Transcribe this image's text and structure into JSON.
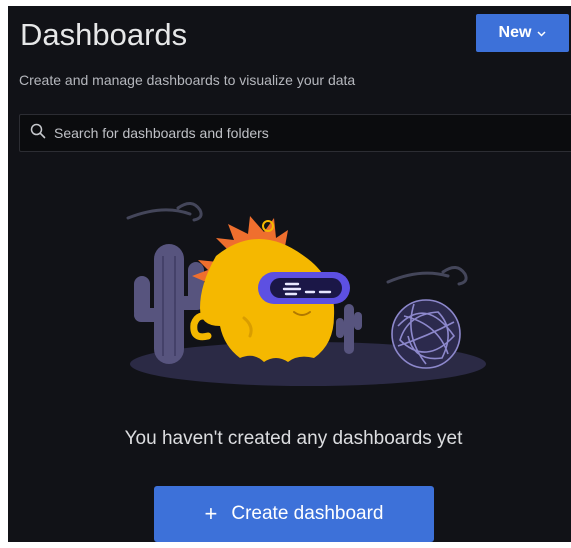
{
  "header": {
    "title": "Dashboards",
    "subtitle": "Create and manage dashboards to visualize your data",
    "new_button_label": "New",
    "new_button_icon": "chevron-down-icon"
  },
  "search": {
    "placeholder": "Search for dashboards and folders",
    "value": "",
    "icon": "search-icon"
  },
  "empty_state": {
    "message": "You haven't created any dashboards yet",
    "create_button_label": "Create dashboard",
    "create_button_icon": "plus-icon"
  },
  "colors": {
    "background": "#111217",
    "primary_button": "#3d71d9",
    "mascot_body": "#f5b800",
    "mascot_crest": "#f0702c",
    "visor": "#5b4fe0",
    "cactus": "#5a5680",
    "tumbleweed": "#8a85c8"
  }
}
